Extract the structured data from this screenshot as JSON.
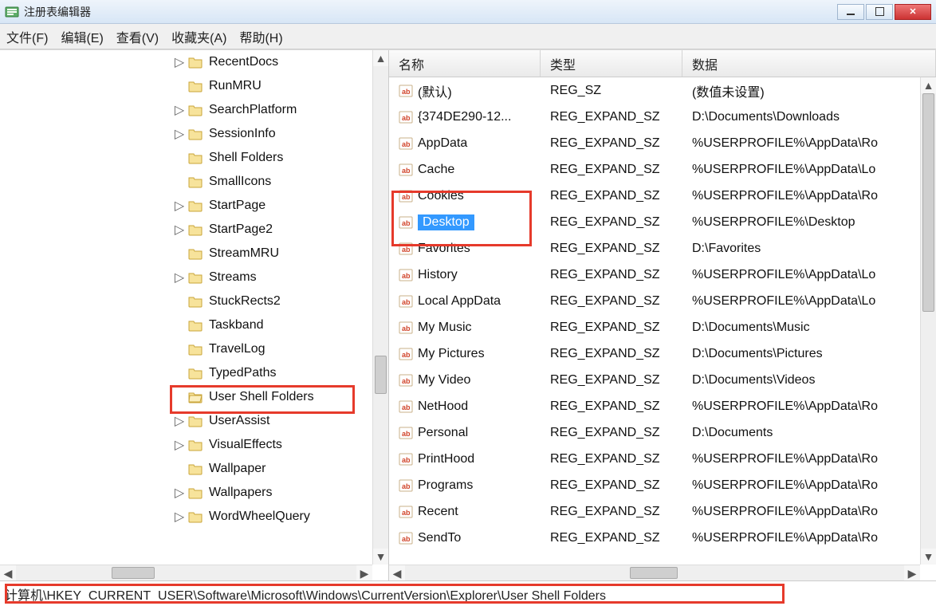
{
  "window": {
    "title": "注册表编辑器"
  },
  "menu": {
    "file": "文件(F)",
    "edit": "编辑(E)",
    "view": "查看(V)",
    "favorites": "收藏夹(A)",
    "help": "帮助(H)"
  },
  "tree": {
    "items": [
      {
        "label": "RecentDocs",
        "expander": "▷"
      },
      {
        "label": "RunMRU",
        "expander": ""
      },
      {
        "label": "SearchPlatform",
        "expander": "▷"
      },
      {
        "label": "SessionInfo",
        "expander": "▷"
      },
      {
        "label": "Shell Folders",
        "expander": ""
      },
      {
        "label": "SmallIcons",
        "expander": ""
      },
      {
        "label": "StartPage",
        "expander": "▷"
      },
      {
        "label": "StartPage2",
        "expander": "▷"
      },
      {
        "label": "StreamMRU",
        "expander": ""
      },
      {
        "label": "Streams",
        "expander": "▷"
      },
      {
        "label": "StuckRects2",
        "expander": ""
      },
      {
        "label": "Taskband",
        "expander": ""
      },
      {
        "label": "TravelLog",
        "expander": ""
      },
      {
        "label": "TypedPaths",
        "expander": ""
      },
      {
        "label": "User Shell Folders",
        "expander": "",
        "highlight": true,
        "open": true
      },
      {
        "label": "UserAssist",
        "expander": "▷"
      },
      {
        "label": "VisualEffects",
        "expander": "▷"
      },
      {
        "label": "Wallpaper",
        "expander": ""
      },
      {
        "label": "Wallpapers",
        "expander": "▷"
      },
      {
        "label": "WordWheelQuery",
        "expander": "▷"
      }
    ]
  },
  "list": {
    "columns": {
      "name": "名称",
      "type": "类型",
      "data": "数据"
    },
    "rows": [
      {
        "name": "(默认)",
        "type": "REG_SZ",
        "data": "(数值未设置)"
      },
      {
        "name": "{374DE290-12...",
        "type": "REG_EXPAND_SZ",
        "data": "D:\\Documents\\Downloads"
      },
      {
        "name": "AppData",
        "type": "REG_EXPAND_SZ",
        "data": "%USERPROFILE%\\AppData\\Ro"
      },
      {
        "name": "Cache",
        "type": "REG_EXPAND_SZ",
        "data": "%USERPROFILE%\\AppData\\Lo"
      },
      {
        "name": "Cookies",
        "type": "REG_EXPAND_SZ",
        "data": "%USERPROFILE%\\AppData\\Ro"
      },
      {
        "name": "Desktop",
        "type": "REG_EXPAND_SZ",
        "data": "%USERPROFILE%\\Desktop",
        "selected": true,
        "highlight": true
      },
      {
        "name": "Favorites",
        "type": "REG_EXPAND_SZ",
        "data": "D:\\Favorites"
      },
      {
        "name": "History",
        "type": "REG_EXPAND_SZ",
        "data": "%USERPROFILE%\\AppData\\Lo"
      },
      {
        "name": "Local AppData",
        "type": "REG_EXPAND_SZ",
        "data": "%USERPROFILE%\\AppData\\Lo"
      },
      {
        "name": "My Music",
        "type": "REG_EXPAND_SZ",
        "data": "D:\\Documents\\Music"
      },
      {
        "name": "My Pictures",
        "type": "REG_EXPAND_SZ",
        "data": "D:\\Documents\\Pictures"
      },
      {
        "name": "My Video",
        "type": "REG_EXPAND_SZ",
        "data": "D:\\Documents\\Videos"
      },
      {
        "name": "NetHood",
        "type": "REG_EXPAND_SZ",
        "data": "%USERPROFILE%\\AppData\\Ro"
      },
      {
        "name": "Personal",
        "type": "REG_EXPAND_SZ",
        "data": "D:\\Documents"
      },
      {
        "name": "PrintHood",
        "type": "REG_EXPAND_SZ",
        "data": "%USERPROFILE%\\AppData\\Ro"
      },
      {
        "name": "Programs",
        "type": "REG_EXPAND_SZ",
        "data": "%USERPROFILE%\\AppData\\Ro"
      },
      {
        "name": "Recent",
        "type": "REG_EXPAND_SZ",
        "data": "%USERPROFILE%\\AppData\\Ro"
      },
      {
        "name": "SendTo",
        "type": "REG_EXPAND_SZ",
        "data": "%USERPROFILE%\\AppData\\Ro"
      }
    ]
  },
  "status": {
    "path": "计算机\\HKEY_CURRENT_USER\\Software\\Microsoft\\Windows\\CurrentVersion\\Explorer\\User Shell Folders"
  }
}
